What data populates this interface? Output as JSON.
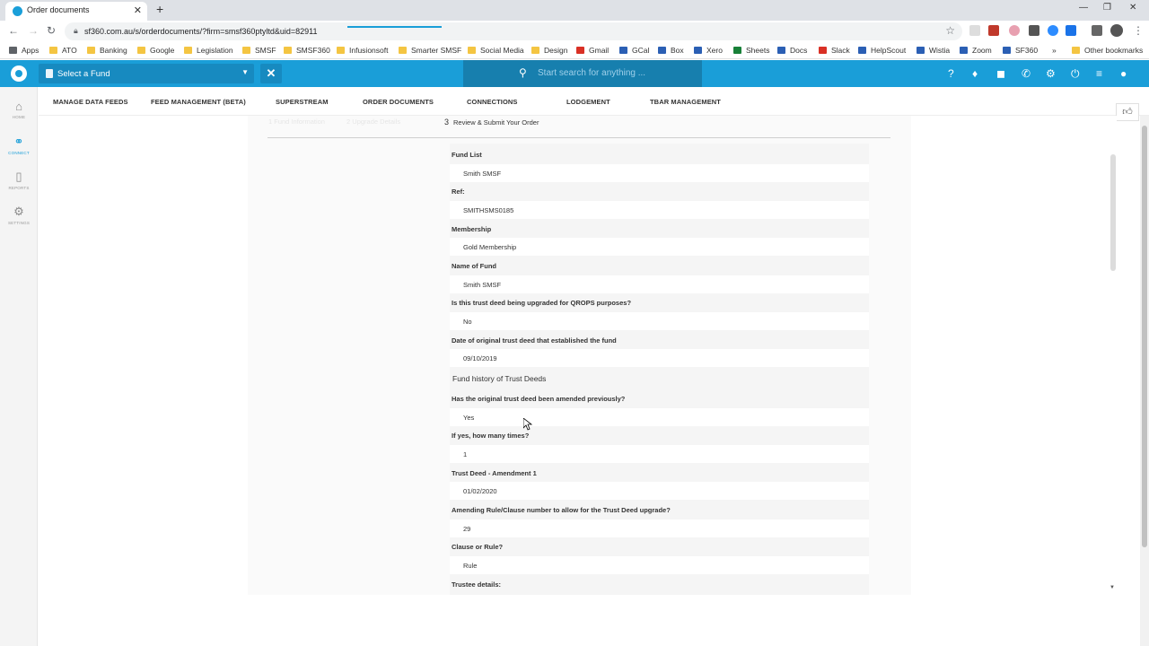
{
  "browser": {
    "tab_title": "Order documents",
    "url": "sf360.com.au/s/orderdocuments/?firm=smsf360ptyltd&uid=82911",
    "bookmarks": [
      "Apps",
      "ATO",
      "Banking",
      "Google",
      "Legislation",
      "SMSF",
      "SMSF360",
      "Infusionsoft",
      "Smarter SMSF",
      "Social Media",
      "Design",
      "Gmail",
      "GCal",
      "Box",
      "Xero",
      "Sheets",
      "Docs",
      "Slack",
      "HelpScout",
      "Wistia",
      "Zoom",
      "SF360"
    ],
    "other_bookmarks": "Other bookmarks"
  },
  "app": {
    "fund_selector": "Select a Fund",
    "search_placeholder": "Start search for anything ..."
  },
  "sidebar": {
    "items": [
      {
        "label": "HOME",
        "icon": "home-icon"
      },
      {
        "label": "CONNECT",
        "icon": "link-icon"
      },
      {
        "label": "REPORTS",
        "icon": "pdf-icon"
      },
      {
        "label": "SETTINGS",
        "icon": "gear-icon"
      }
    ]
  },
  "subnav": {
    "tabs": [
      "MANAGE DATA FEEDS",
      "FEED MANAGEMENT (BETA)",
      "SUPERSTREAM",
      "ORDER DOCUMENTS",
      "CONNECTIONS",
      "LODGEMENT",
      "TBAR MANAGEMENT"
    ],
    "active": "ORDER DOCUMENTS"
  },
  "steps": {
    "step1": "1  Fund Information",
    "step2": "2  Upgrade Details",
    "step3_num": "3",
    "step3_label": "Review & Submit Your Order"
  },
  "form": {
    "fields": [
      {
        "label": "Fund List",
        "value": "Smith SMSF"
      },
      {
        "label": "Ref:",
        "value": "SMITHSMS0185"
      },
      {
        "label": "Membership",
        "value": "Gold Membership"
      },
      {
        "label": "Name of Fund",
        "value": "Smith SMSF"
      },
      {
        "label": "Is this trust deed being upgraded for QROPS purposes?",
        "value": "No"
      },
      {
        "label": "Date of original trust deed that established the fund",
        "value": "09/10/2019"
      }
    ],
    "section_title": "Fund history of Trust Deeds",
    "fields2": [
      {
        "label": "Has the original trust deed been amended previously?",
        "value": "Yes"
      },
      {
        "label": "If yes, how many times?",
        "value": "1"
      },
      {
        "label": "Trust Deed - Amendment 1",
        "value": "01/02/2020"
      },
      {
        "label": "Amending Rule/Clause number to allow for the Trust Deed upgrade?",
        "value": "29"
      },
      {
        "label": "Clause or Rule?",
        "value": "Rule"
      }
    ],
    "last_label": "Trustee details:"
  }
}
